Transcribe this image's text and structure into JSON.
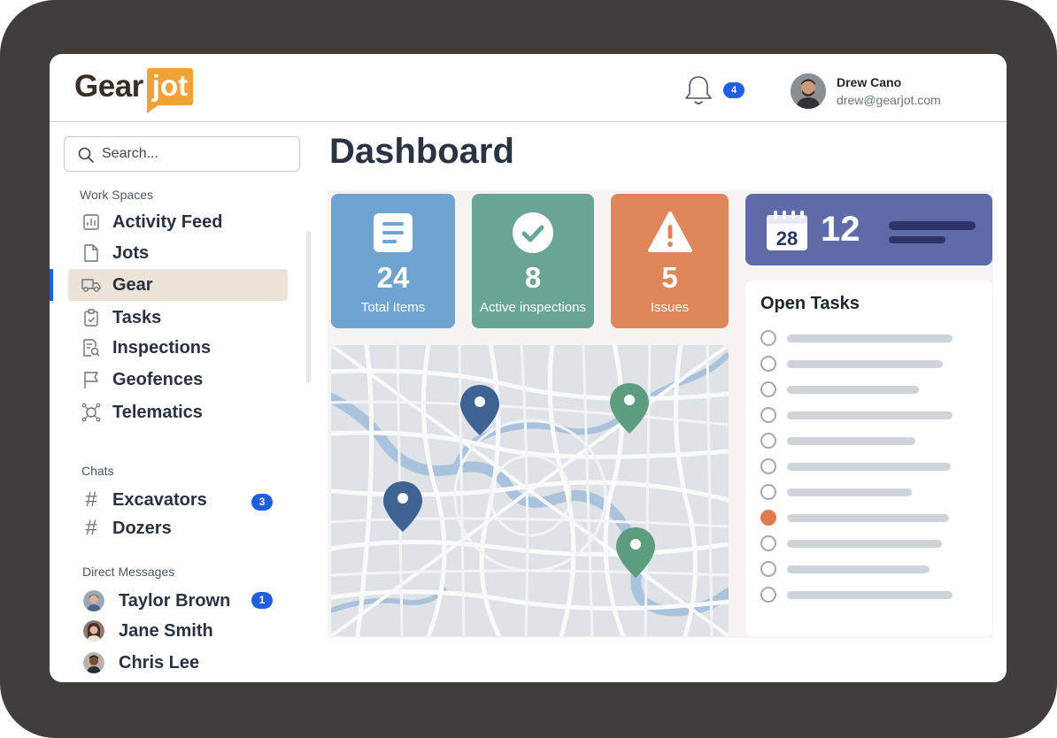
{
  "brand": {
    "name_part1": "Gear",
    "name_part2": "jot",
    "accent": "#f0a234"
  },
  "header": {
    "notifications_count": "4",
    "user": {
      "name": "Drew Cano",
      "email": "drew@gearjot.com"
    }
  },
  "search": {
    "placeholder": "Search..."
  },
  "sidebar": {
    "workspaces_label": "Work Spaces",
    "workspaces": [
      {
        "label": "Activity Feed",
        "icon": "chart-icon"
      },
      {
        "label": "Jots",
        "icon": "document-icon"
      },
      {
        "label": "Gear",
        "icon": "truck-icon",
        "active": true
      },
      {
        "label": "Tasks",
        "icon": "clipboard-icon"
      },
      {
        "label": "Inspections",
        "icon": "inspection-icon"
      },
      {
        "label": "Geofences",
        "icon": "flag-icon"
      },
      {
        "label": "Telematics",
        "icon": "network-icon"
      }
    ],
    "chats_label": "Chats",
    "chats": [
      {
        "label": "Excavators",
        "badge": "3"
      },
      {
        "label": "Dozers",
        "badge": ""
      }
    ],
    "dm_label": "Direct Messages",
    "dms": [
      {
        "label": "Taylor Brown",
        "badge": "1"
      },
      {
        "label": "Jane Smith",
        "badge": ""
      },
      {
        "label": "Chris Lee",
        "badge": ""
      }
    ]
  },
  "main": {
    "title": "Dashboard",
    "stats": [
      {
        "value": "24",
        "label": "Total Items",
        "color": "#6fa3d0",
        "icon": "list-icon"
      },
      {
        "value": "8",
        "label": "Active inspections",
        "color": "#68a596",
        "icon": "check-icon"
      },
      {
        "value": "5",
        "label": "Issues",
        "color": "#e0875a",
        "icon": "warning-icon"
      }
    ],
    "calendar": {
      "day": "28",
      "count": "12",
      "color": "#5f6aa8"
    },
    "tasks": {
      "title": "Open Tasks",
      "items": [
        {
          "done": false
        },
        {
          "done": false
        },
        {
          "done": false
        },
        {
          "done": false
        },
        {
          "done": false
        },
        {
          "done": false
        },
        {
          "done": false
        },
        {
          "done": true
        },
        {
          "done": false
        },
        {
          "done": false
        },
        {
          "done": false
        }
      ]
    },
    "map": {
      "pins": [
        {
          "color": "#3d6392"
        },
        {
          "color": "#5b9d7d"
        },
        {
          "color": "#3d6392"
        },
        {
          "color": "#5b9d7d"
        }
      ]
    }
  }
}
